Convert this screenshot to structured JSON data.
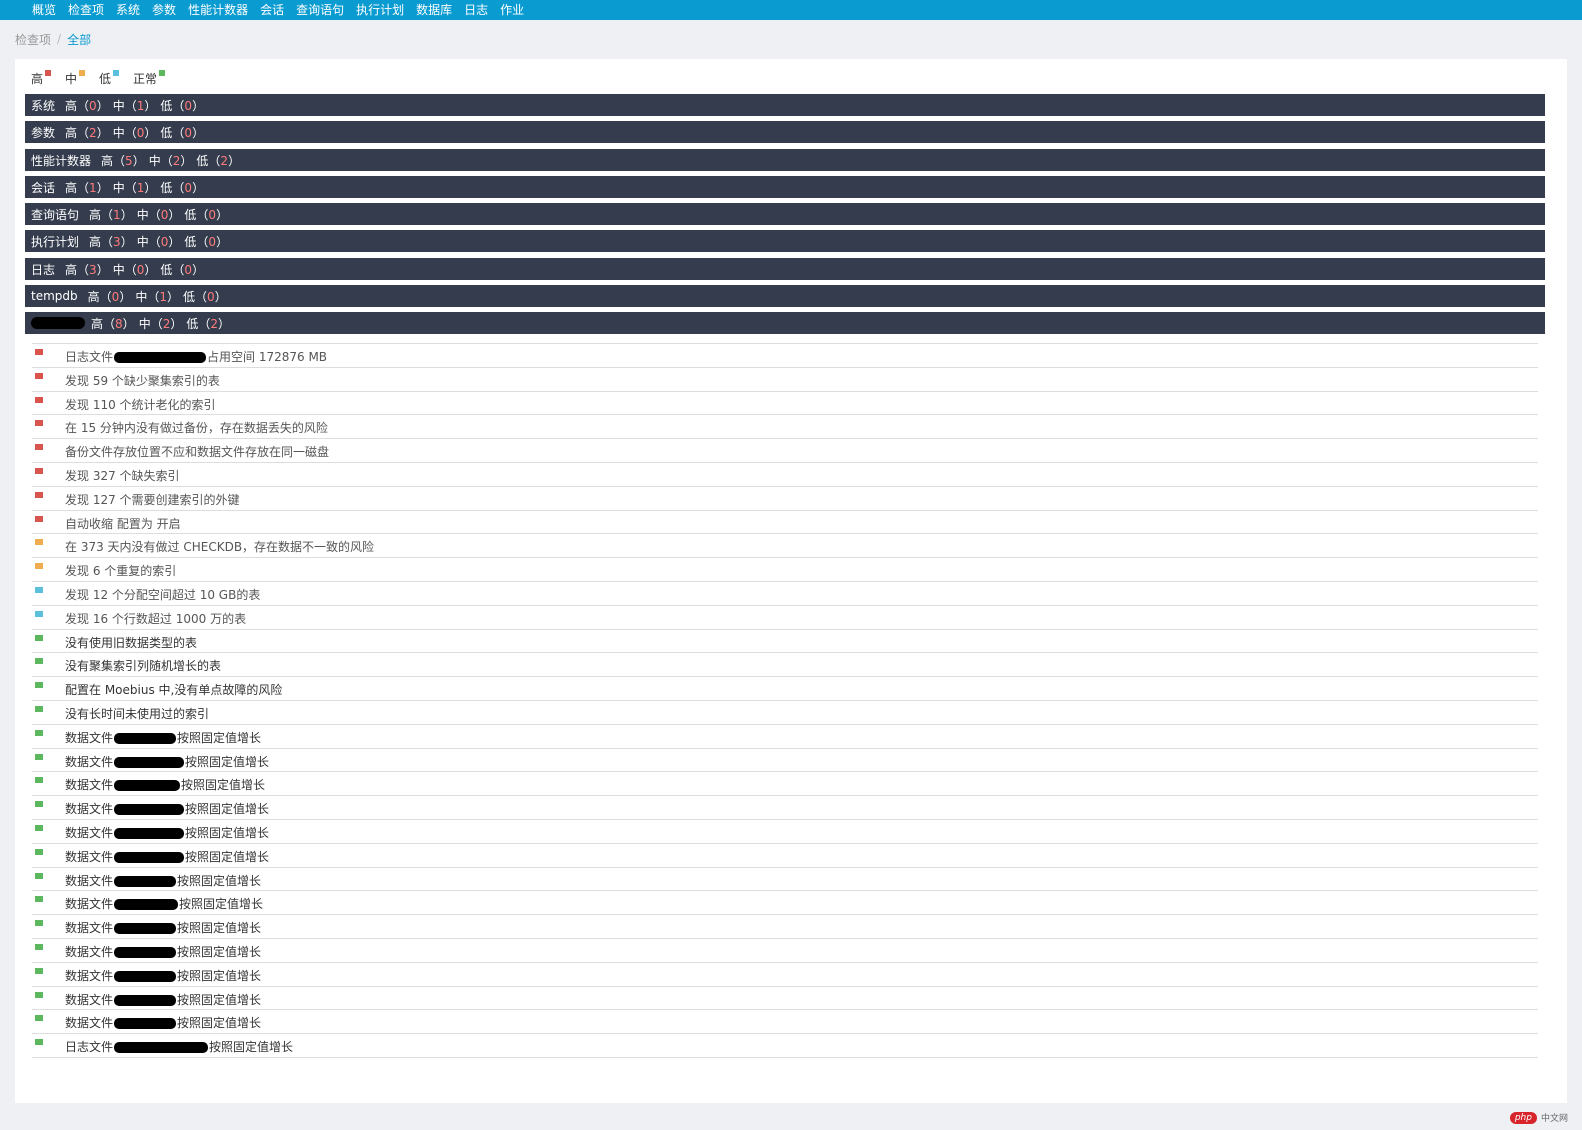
{
  "nav": {
    "items": [
      "概览",
      "检查项",
      "系统",
      "参数",
      "性能计数器",
      "会话",
      "查询语句",
      "执行计划",
      "数据库",
      "日志",
      "作业"
    ]
  },
  "breadcrumb": {
    "parent": "检查项",
    "separator": "/",
    "current": "全部"
  },
  "legend": [
    {
      "label": "高",
      "color": "#d9534f"
    },
    {
      "label": "中",
      "color": "#f0ad4e"
    },
    {
      "label": "低",
      "color": "#5bc0de"
    },
    {
      "label": "正常",
      "color": "#5cb85c"
    }
  ],
  "severity_labels": {
    "high": "高",
    "medium": "中",
    "low": "低"
  },
  "categories": [
    {
      "name": "系统",
      "high": "0",
      "medium": "1",
      "low": "0"
    },
    {
      "name": "参数",
      "high": "2",
      "medium": "0",
      "low": "0"
    },
    {
      "name": "性能计数器",
      "high": "5",
      "medium": "2",
      "low": "2"
    },
    {
      "name": "会话",
      "high": "1",
      "medium": "1",
      "low": "0"
    },
    {
      "name": "查询语句",
      "high": "1",
      "medium": "0",
      "low": "0"
    },
    {
      "name": "执行计划",
      "high": "3",
      "medium": "0",
      "low": "0"
    },
    {
      "name": "日志",
      "high": "3",
      "medium": "0",
      "low": "0"
    },
    {
      "name": "tempdb",
      "high": "0",
      "medium": "1",
      "low": "0"
    },
    {
      "name": "",
      "high": "8",
      "medium": "2",
      "low": "2"
    }
  ],
  "issues": [
    {
      "level": "high",
      "pre": "日志文件",
      "masked": true,
      "post": "占用空间 172876 MB"
    },
    {
      "level": "high",
      "pre": "发现 59 个缺少聚集索引的表"
    },
    {
      "level": "high",
      "pre": "发现 110 个统计老化的索引"
    },
    {
      "level": "high",
      "pre": "在 15 分钟内没有做过备份，存在数据丢失的风险"
    },
    {
      "level": "high",
      "pre": "备份文件存放位置不应和数据文件存放在同一磁盘"
    },
    {
      "level": "high",
      "pre": "发现 327 个缺失索引"
    },
    {
      "level": "high",
      "pre": "发现 127 个需要创建索引的外键"
    },
    {
      "level": "high",
      "pre": "自动收缩 配置为 开启"
    },
    {
      "level": "medium",
      "pre": "在 373 天内没有做过 CHECKDB，存在数据不一致的风险"
    },
    {
      "level": "medium",
      "pre": "发现 6 个重复的索引"
    },
    {
      "level": "low",
      "pre": "发现 12 个分配空间超过 10 GB的表"
    },
    {
      "level": "low",
      "pre": "发现 16 个行数超过 1000 万的表"
    },
    {
      "level": "normal",
      "pre": "没有使用旧数据类型的表"
    },
    {
      "level": "normal",
      "pre": "没有聚集索引列随机增长的表"
    },
    {
      "level": "normal",
      "pre": "配置在 Moebius 中,没有单点故障的风险"
    },
    {
      "level": "normal",
      "pre": "没有长时间未使用过的索引"
    },
    {
      "level": "normal",
      "pre": "数据文件",
      "masked": true,
      "post": "按照固定值增长"
    },
    {
      "level": "normal",
      "pre": "数据文件",
      "masked": true,
      "post": "按照固定值增长"
    },
    {
      "level": "normal",
      "pre": "数据文件",
      "masked": true,
      "post": "按照固定值增长"
    },
    {
      "level": "normal",
      "pre": "数据文件",
      "masked": true,
      "post": "按照固定值增长"
    },
    {
      "level": "normal",
      "pre": "数据文件",
      "masked": true,
      "post": "按照固定值增长"
    },
    {
      "level": "normal",
      "pre": "数据文件",
      "masked": true,
      "post": "按照固定值增长"
    },
    {
      "level": "normal",
      "pre": "数据文件",
      "masked": true,
      "post": "按照固定值增长"
    },
    {
      "level": "normal",
      "pre": "数据文件",
      "masked": true,
      "post": "按照固定值增长"
    },
    {
      "level": "normal",
      "pre": "数据文件",
      "masked": true,
      "post": "按照固定值增长"
    },
    {
      "level": "normal",
      "pre": "数据文件",
      "masked": true,
      "post": "按照固定值增长"
    },
    {
      "level": "normal",
      "pre": "数据文件",
      "masked": true,
      "post": "按照固定值增长"
    },
    {
      "level": "normal",
      "pre": "数据文件",
      "masked": true,
      "post": "按照固定值增长"
    },
    {
      "level": "normal",
      "pre": "数据文件",
      "masked": true,
      "post": "按照固定值增长"
    },
    {
      "level": "normal",
      "pre": "日志文件",
      "masked": true,
      "post": "按照固定值增长"
    }
  ],
  "level_colors": {
    "high": "#d9534f",
    "medium": "#f0ad4e",
    "low": "#5bc0de",
    "normal": "#5cb85c"
  },
  "watermark": {
    "badge": "php",
    "text": "中文网"
  }
}
